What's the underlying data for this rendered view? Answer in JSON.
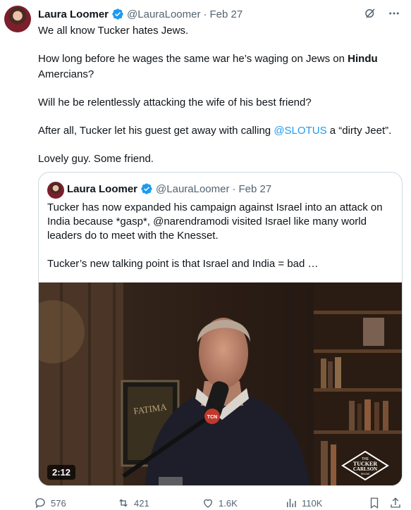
{
  "tweet": {
    "author_name": "Laura Loomer",
    "handle": "@LauraLoomer",
    "separator": "·",
    "date": "Feb 27",
    "lines": {
      "l1": "We all know Tucker hates Jews.",
      "l2a": "How long before he wages the same war he’s waging on Jews on ",
      "l2b": "Hindu",
      "l2c": "Amercians?",
      "l3": "Will he be relentlessly attacking the wife of his best friend?",
      "l4a": "After all, Tucker let his guest get away with calling ",
      "l4b": "@SLOTUS",
      "l4c": " a “dirty Jeet”.",
      "l5": "Lovely guy. Some friend."
    }
  },
  "quote": {
    "author_name": "Laura Loomer",
    "handle": "@LauraLoomer",
    "separator": "·",
    "date": "Feb 27",
    "p1": "Tucker has now expanded his campaign against Israel into an attack on India because *gasp*, @narendramodi visited Israel like many world leaders do to meet with the Knesset.",
    "p2": "Tucker’s new talking point is that Israel and India = bad …",
    "video": {
      "duration": "2:12",
      "poster_text": "FATIMA",
      "mic_label": "TCN",
      "logo_line1": "THE",
      "logo_line2": "TUCKER",
      "logo_line3": "CARLSON",
      "logo_line4": "SHOW"
    }
  },
  "actions": {
    "replies": "576",
    "reposts": "421",
    "likes": "1.6K",
    "views": "110K"
  },
  "icons": [
    "verified-badge-icon",
    "grok-icon",
    "more-icon",
    "reply-icon",
    "repost-icon",
    "like-icon",
    "views-icon",
    "bookmark-icon",
    "share-icon"
  ],
  "colors": {
    "accent": "#1d9bf0",
    "text": "#0f1419",
    "muted": "#536471",
    "border": "#cfd9de"
  }
}
